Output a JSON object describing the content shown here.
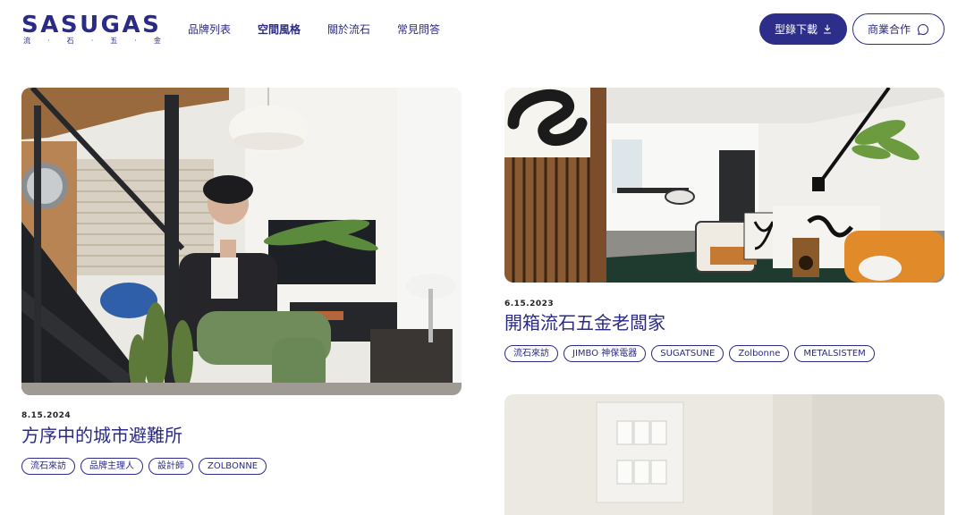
{
  "header": {
    "logo_text": "SASUGAS",
    "logo_sub": [
      "流",
      "·",
      "石",
      "·",
      "五",
      "·",
      "金"
    ],
    "nav": [
      {
        "label": "品牌列表",
        "active": false
      },
      {
        "label": "空間風格",
        "active": true
      },
      {
        "label": "關於流石",
        "active": false
      },
      {
        "label": "常見問答",
        "active": false
      }
    ],
    "download_label": "型錄下載",
    "contact_label": "商業合作"
  },
  "posts": [
    {
      "date": "8.15.2024",
      "title": "方序中的城市避難所",
      "tags": [
        "流石來訪",
        "品牌主理人",
        "設計師",
        "ZOLBONNE"
      ]
    },
    {
      "date": "6.15.2023",
      "title": "開箱流石五金老闆家",
      "tags": [
        "流石來訪",
        "JIMBO 神保電器",
        "SUGATSUNE",
        "Zolbonne",
        "METALSISTEM"
      ]
    },
    {
      "date": "",
      "title": "",
      "tags": []
    }
  ],
  "colors": {
    "brand": "#2b2a86",
    "button_bg": "#2d2d8a",
    "text": "#222222"
  }
}
